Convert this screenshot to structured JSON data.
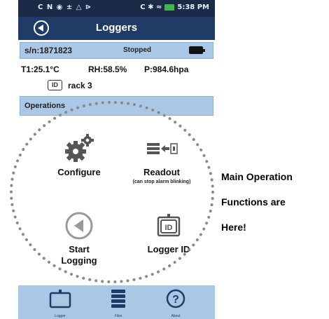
{
  "status_bar": {
    "left_icons": "C N ◉ ± △ ⊳",
    "right_icons": "C ✱ ≈",
    "time": "5:38 PM"
  },
  "header": {
    "title": "Loggers",
    "back_icon": "back-arrow-circle-icon"
  },
  "device": {
    "serial": "s/n:1871823",
    "state": "Stopped",
    "battery_icon": "battery-icon"
  },
  "readings": {
    "t1": "T1:25.1°C",
    "rh": "RH:58.5%",
    "pressure": "P:984.6hpa"
  },
  "tag": {
    "badge": "ID",
    "name": "rack 3"
  },
  "operations": {
    "header": "Operations",
    "items": [
      {
        "label": "Configure",
        "sub": "",
        "icon": "gear-icon"
      },
      {
        "label": "Readout",
        "sub": "(can stop alarm blinking)",
        "icon": "readout-icon"
      },
      {
        "label": "Start",
        "label2": "Logging",
        "sub": "",
        "icon": "play-back-circle-icon"
      },
      {
        "label": "Logger ID",
        "sub": "",
        "icon": "id-card-icon",
        "badge": "ID"
      }
    ]
  },
  "bottom_nav": {
    "items": [
      {
        "label": "Logger",
        "icon": "logger-icon"
      },
      {
        "label": "Files",
        "icon": "files-icon"
      },
      {
        "label": "About",
        "icon": "help-circle-icon",
        "glyph": "?"
      }
    ]
  },
  "annotation": {
    "line1": "Main Operation",
    "line2": "Functions are",
    "line3": "Here!"
  },
  "colors": {
    "status_bar": "#1b2b47",
    "title_bar": "#1f3b66",
    "accent_light": "#aac8e6",
    "icon_gray": "#555555",
    "dots": "#8a8a8a"
  }
}
